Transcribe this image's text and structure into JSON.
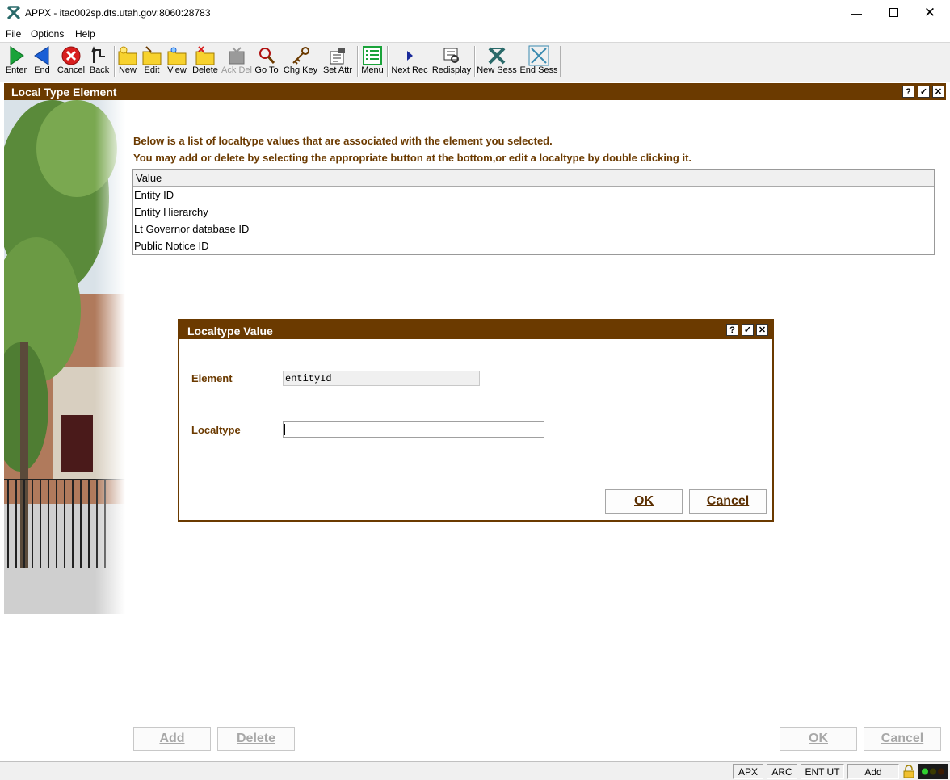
{
  "window": {
    "title": "APPX - itac002sp.dts.utah.gov:8060:28783"
  },
  "menu": [
    "File",
    "Options",
    "Help"
  ],
  "toolbar": [
    {
      "label": "Enter",
      "icon": "enter-icon"
    },
    {
      "label": "End",
      "icon": "end-icon"
    },
    {
      "label": "Cancel",
      "icon": "cancel-icon"
    },
    {
      "label": "Back",
      "icon": "back-icon"
    },
    {
      "label": "New",
      "icon": "new-folder-icon"
    },
    {
      "label": "Edit",
      "icon": "edit-folder-icon"
    },
    {
      "label": "View",
      "icon": "view-folder-icon"
    },
    {
      "label": "Delete",
      "icon": "delete-folder-icon"
    },
    {
      "label": "Ack Del",
      "icon": "ack-delete-icon",
      "disabled": true
    },
    {
      "label": "Go To",
      "icon": "magnifier-icon"
    },
    {
      "label": "Chg Key",
      "icon": "key-icon"
    },
    {
      "label": "Set Attr",
      "icon": "set-attr-icon"
    },
    {
      "label": "Menu",
      "icon": "menu-list-icon"
    },
    {
      "label": "Next Rec",
      "icon": "next-arrow-icon"
    },
    {
      "label": "Redisplay",
      "icon": "redisplay-icon"
    },
    {
      "label": "New Sess",
      "icon": "new-session-icon"
    },
    {
      "label": "End Sess",
      "icon": "end-session-icon"
    }
  ],
  "frame": {
    "title": "Local Type Element",
    "header_buttons": [
      "?",
      "✓",
      "✕"
    ],
    "instruction_1": "Below is a list of localtype values that are associated with the element you selected.",
    "instruction_2": "You may add or delete by selecting the appropriate button at the bottom,or edit a localtype by double clicking it.",
    "grid": {
      "column": "Value",
      "rows": [
        "Entity ID",
        "Entity Hierarchy",
        "Lt Governor database ID",
        "Public Notice ID"
      ]
    },
    "buttons": {
      "add": "Add",
      "delete": "Delete",
      "ok": "OK",
      "cancel": "Cancel"
    }
  },
  "dialog": {
    "title": "Localtype Value",
    "header_buttons": [
      "?",
      "✓",
      "✕"
    ],
    "element_label": "Element",
    "element_value": "entityId",
    "localtype_label": "Localtype",
    "localtype_value": "",
    "ok": "OK",
    "cancel": "Cancel"
  },
  "statusbar": [
    "APX",
    "ARC",
    "ENT UT",
    "Add"
  ],
  "colors": {
    "brand_brown": "#6b3a00",
    "toolbar_bg": "#f0f0f0"
  }
}
